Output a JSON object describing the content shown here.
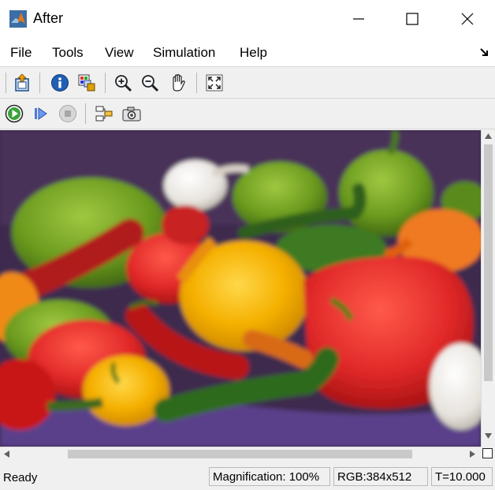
{
  "window": {
    "title": "After",
    "icon": "matlab-icon",
    "controls": {
      "minimize": "minimize-icon",
      "maximize": "maximize-icon",
      "close": "close-icon"
    }
  },
  "menu": {
    "items": [
      "File",
      "Tools",
      "View",
      "Simulation",
      "Help"
    ],
    "dock_icon": "dock-arrow-icon"
  },
  "toolbar1": {
    "buttons": [
      "print-to-figure-icon",
      "info-icon",
      "pixel-region-icon",
      "zoom-in-icon",
      "zoom-out-icon",
      "pan-hand-icon",
      "fit-to-window-icon"
    ]
  },
  "toolbar2": {
    "buttons": [
      "start-icon",
      "step-forward-icon",
      "stop-icon",
      "library-browser-icon",
      "snapshot-icon"
    ]
  },
  "viewport": {
    "content": "peppers-image",
    "colors": {
      "background": "#3d2a4e",
      "cloth": "#5a3f8a"
    },
    "vertical_scroll_fraction": 0.12,
    "horizontal_scroll_fraction": 0.12
  },
  "status": {
    "ready": "Ready",
    "magnification": "Magnification: 100%",
    "rgb": "RGB:384x512",
    "time": "T=10.000"
  }
}
